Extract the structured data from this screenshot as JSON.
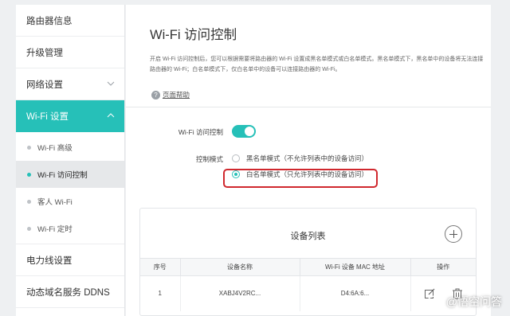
{
  "sidebar": {
    "items": [
      {
        "label": "路由器信息"
      },
      {
        "label": "升级管理"
      },
      {
        "label": "网络设置"
      },
      {
        "label": "Wi-Fi 设置"
      }
    ],
    "wifi_sub": [
      {
        "label": "Wi-Fi 高级"
      },
      {
        "label": "Wi-Fi 访问控制"
      },
      {
        "label": "客人 Wi-Fi"
      },
      {
        "label": "Wi-Fi 定时"
      }
    ],
    "bottom_items": [
      {
        "label": "电力线设置"
      },
      {
        "label": "动态域名服务 DDNS"
      }
    ]
  },
  "main": {
    "title": "Wi-Fi 访问控制",
    "description": "开启 Wi-Fi 访问控制后，您可以根据需要将路由器的 Wi-Fi 设置成黑名单模式或白名单模式。黑名单模式下，黑名单中的设备将无法连接路由器的 Wi-Fi；白名单模式下，仅白名单中的设备可以连接路由器的 Wi-Fi。",
    "help_label": "页面帮助",
    "toggle_label": "Wi-Fi 访问控制",
    "toggle_on": true,
    "mode_label": "控制模式",
    "modes": [
      {
        "label": "黑名单模式（不允许列表中的设备访问）",
        "selected": false
      },
      {
        "label": "白名单模式（只允许列表中的设备访问）",
        "selected": true
      }
    ]
  },
  "device_list": {
    "title": "设备列表",
    "columns": [
      "序号",
      "设备名称",
      "Wi-Fi 设备 MAC 地址",
      "操作"
    ],
    "rows": [
      {
        "index": "1",
        "name": "XABJ4V2RC...",
        "mac": "D4:6A:6..."
      }
    ]
  },
  "watermark": {
    "text": "@悟空问答"
  },
  "colors": {
    "accent": "#26c0b8",
    "highlight": "#d0282e"
  }
}
